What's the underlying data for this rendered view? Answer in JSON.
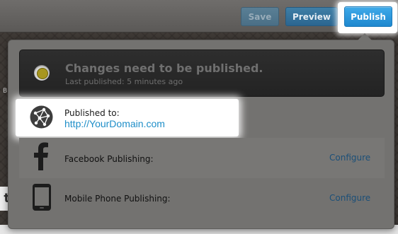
{
  "toolbar": {
    "save_label": "Save",
    "preview_label": "Preview",
    "publish_label": "Publish"
  },
  "status": {
    "title": "Changes need to be published.",
    "subtitle": "Last published: 5 minutes ago",
    "indicator_color": "#a7961f"
  },
  "published_to": {
    "label": "Published to:",
    "url": "http://YourDomain.com",
    "icon": "globe-icon"
  },
  "publishing_options": [
    {
      "label": "Facebook Publishing:",
      "action": "Configure",
      "icon": "facebook-icon"
    },
    {
      "label": "Mobile Phone Publishing:",
      "action": "Configure",
      "icon": "mobile-phone-icon"
    }
  ],
  "background": {
    "left_letter": "B",
    "left_strip_letter": "t"
  },
  "colors": {
    "publish_button": "#1f88cf",
    "link": "#1e8ec8",
    "configure_link": "#1b4f78"
  }
}
